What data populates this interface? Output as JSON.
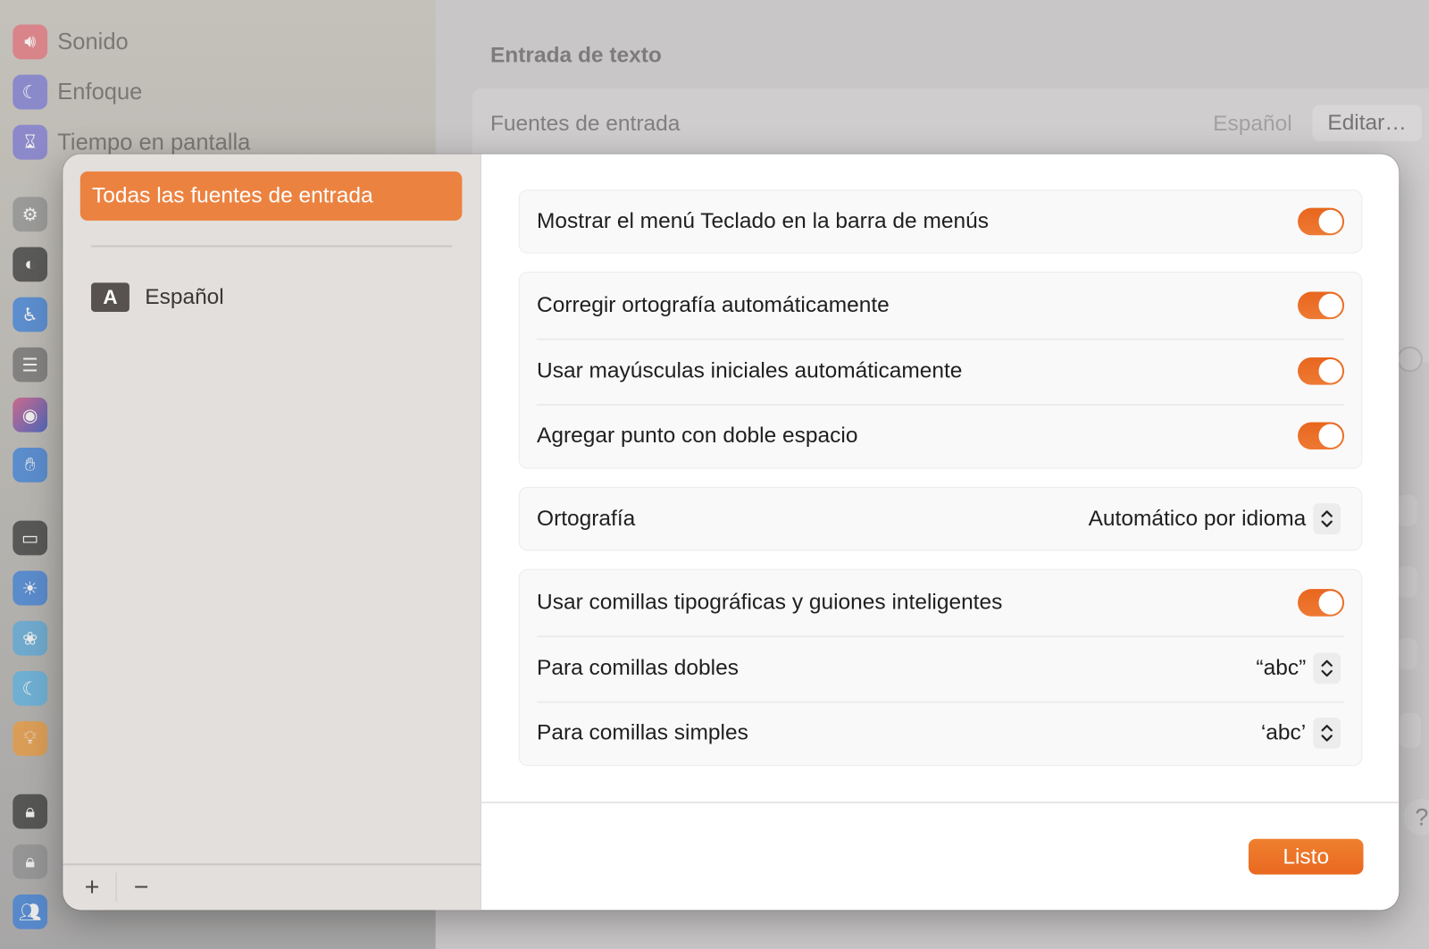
{
  "background": {
    "sidebar_items": [
      {
        "label": "Sonido",
        "icon": "speaker-icon",
        "color": "#e0717a"
      },
      {
        "label": "Enfoque",
        "icon": "moon-icon",
        "color": "#7878d0"
      },
      {
        "label": "Tiempo en pantalla",
        "icon": "hourglass-icon",
        "color": "#7a78d0"
      }
    ],
    "section_title": "Entrada de texto",
    "input_sources_label": "Fuentes de entrada",
    "input_sources_value": "Español",
    "edit_button": "Editar…",
    "help": "?"
  },
  "dialog": {
    "sidebar": {
      "selected_item": "Todas las fuentes de entrada",
      "languages": [
        {
          "badge": "A",
          "label": "Español"
        }
      ],
      "add": "+",
      "remove": "−"
    },
    "settings": {
      "show_menu": {
        "label": "Mostrar el menú Teclado en la barra de menús",
        "on": true
      },
      "auto_correct": {
        "label": "Corregir ortografía automáticamente",
        "on": true
      },
      "auto_caps": {
        "label": "Usar mayúsculas iniciales automáticamente",
        "on": true
      },
      "double_space": {
        "label": "Agregar punto con doble espacio",
        "on": true
      },
      "spelling": {
        "label": "Ortografía",
        "value": "Automático por idioma"
      },
      "smart_quotes": {
        "label": "Usar comillas tipográficas y guiones inteligentes",
        "on": true
      },
      "double_quotes": {
        "label": "Para comillas dobles",
        "value": "“abc”"
      },
      "single_quotes": {
        "label": "Para comillas simples",
        "value": "‘abc’"
      }
    },
    "done_button": "Listo"
  },
  "colors": {
    "accent": "#ec8240",
    "toggle": "#ea6a22"
  }
}
